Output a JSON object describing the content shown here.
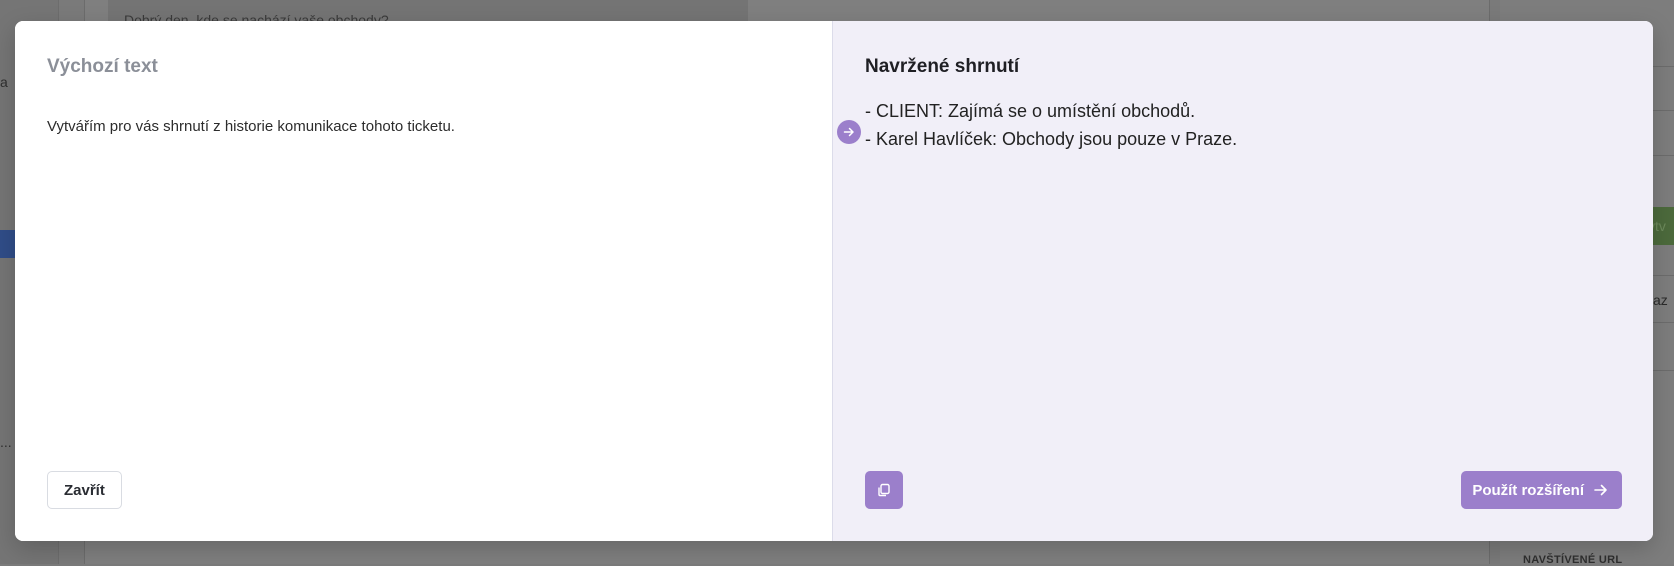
{
  "background": {
    "rail_texts": [
      "a",
      "..."
    ],
    "message_text": "Dobrý den, kde se nachází vaše obchody?",
    "right_button_text": "ytv",
    "right_label_text": "kaz",
    "right_small_heading": "NAVŠTÍVENÉ URL"
  },
  "modal": {
    "left": {
      "title": "Výchozí text",
      "text": "Vytvářím pro vás shrnutí z historie komunikace tohoto ticketu.",
      "close_label": "Zavřít"
    },
    "right": {
      "title": "Navržené shrnutí",
      "summary": [
        "- CLIENT: Zajímá se o umístění obchodů.",
        "- Karel Havlíček: Obchody jsou pouze v Praze."
      ],
      "apply_label": "Použít rozšíření"
    }
  },
  "colors": {
    "accent": "#9b7fcb",
    "right_pane_bg": "#f1eff8"
  },
  "icons": {
    "arrow_badge": "arrow-right-circle-icon",
    "copy": "copy-icon",
    "apply": "arrow-right-icon"
  }
}
